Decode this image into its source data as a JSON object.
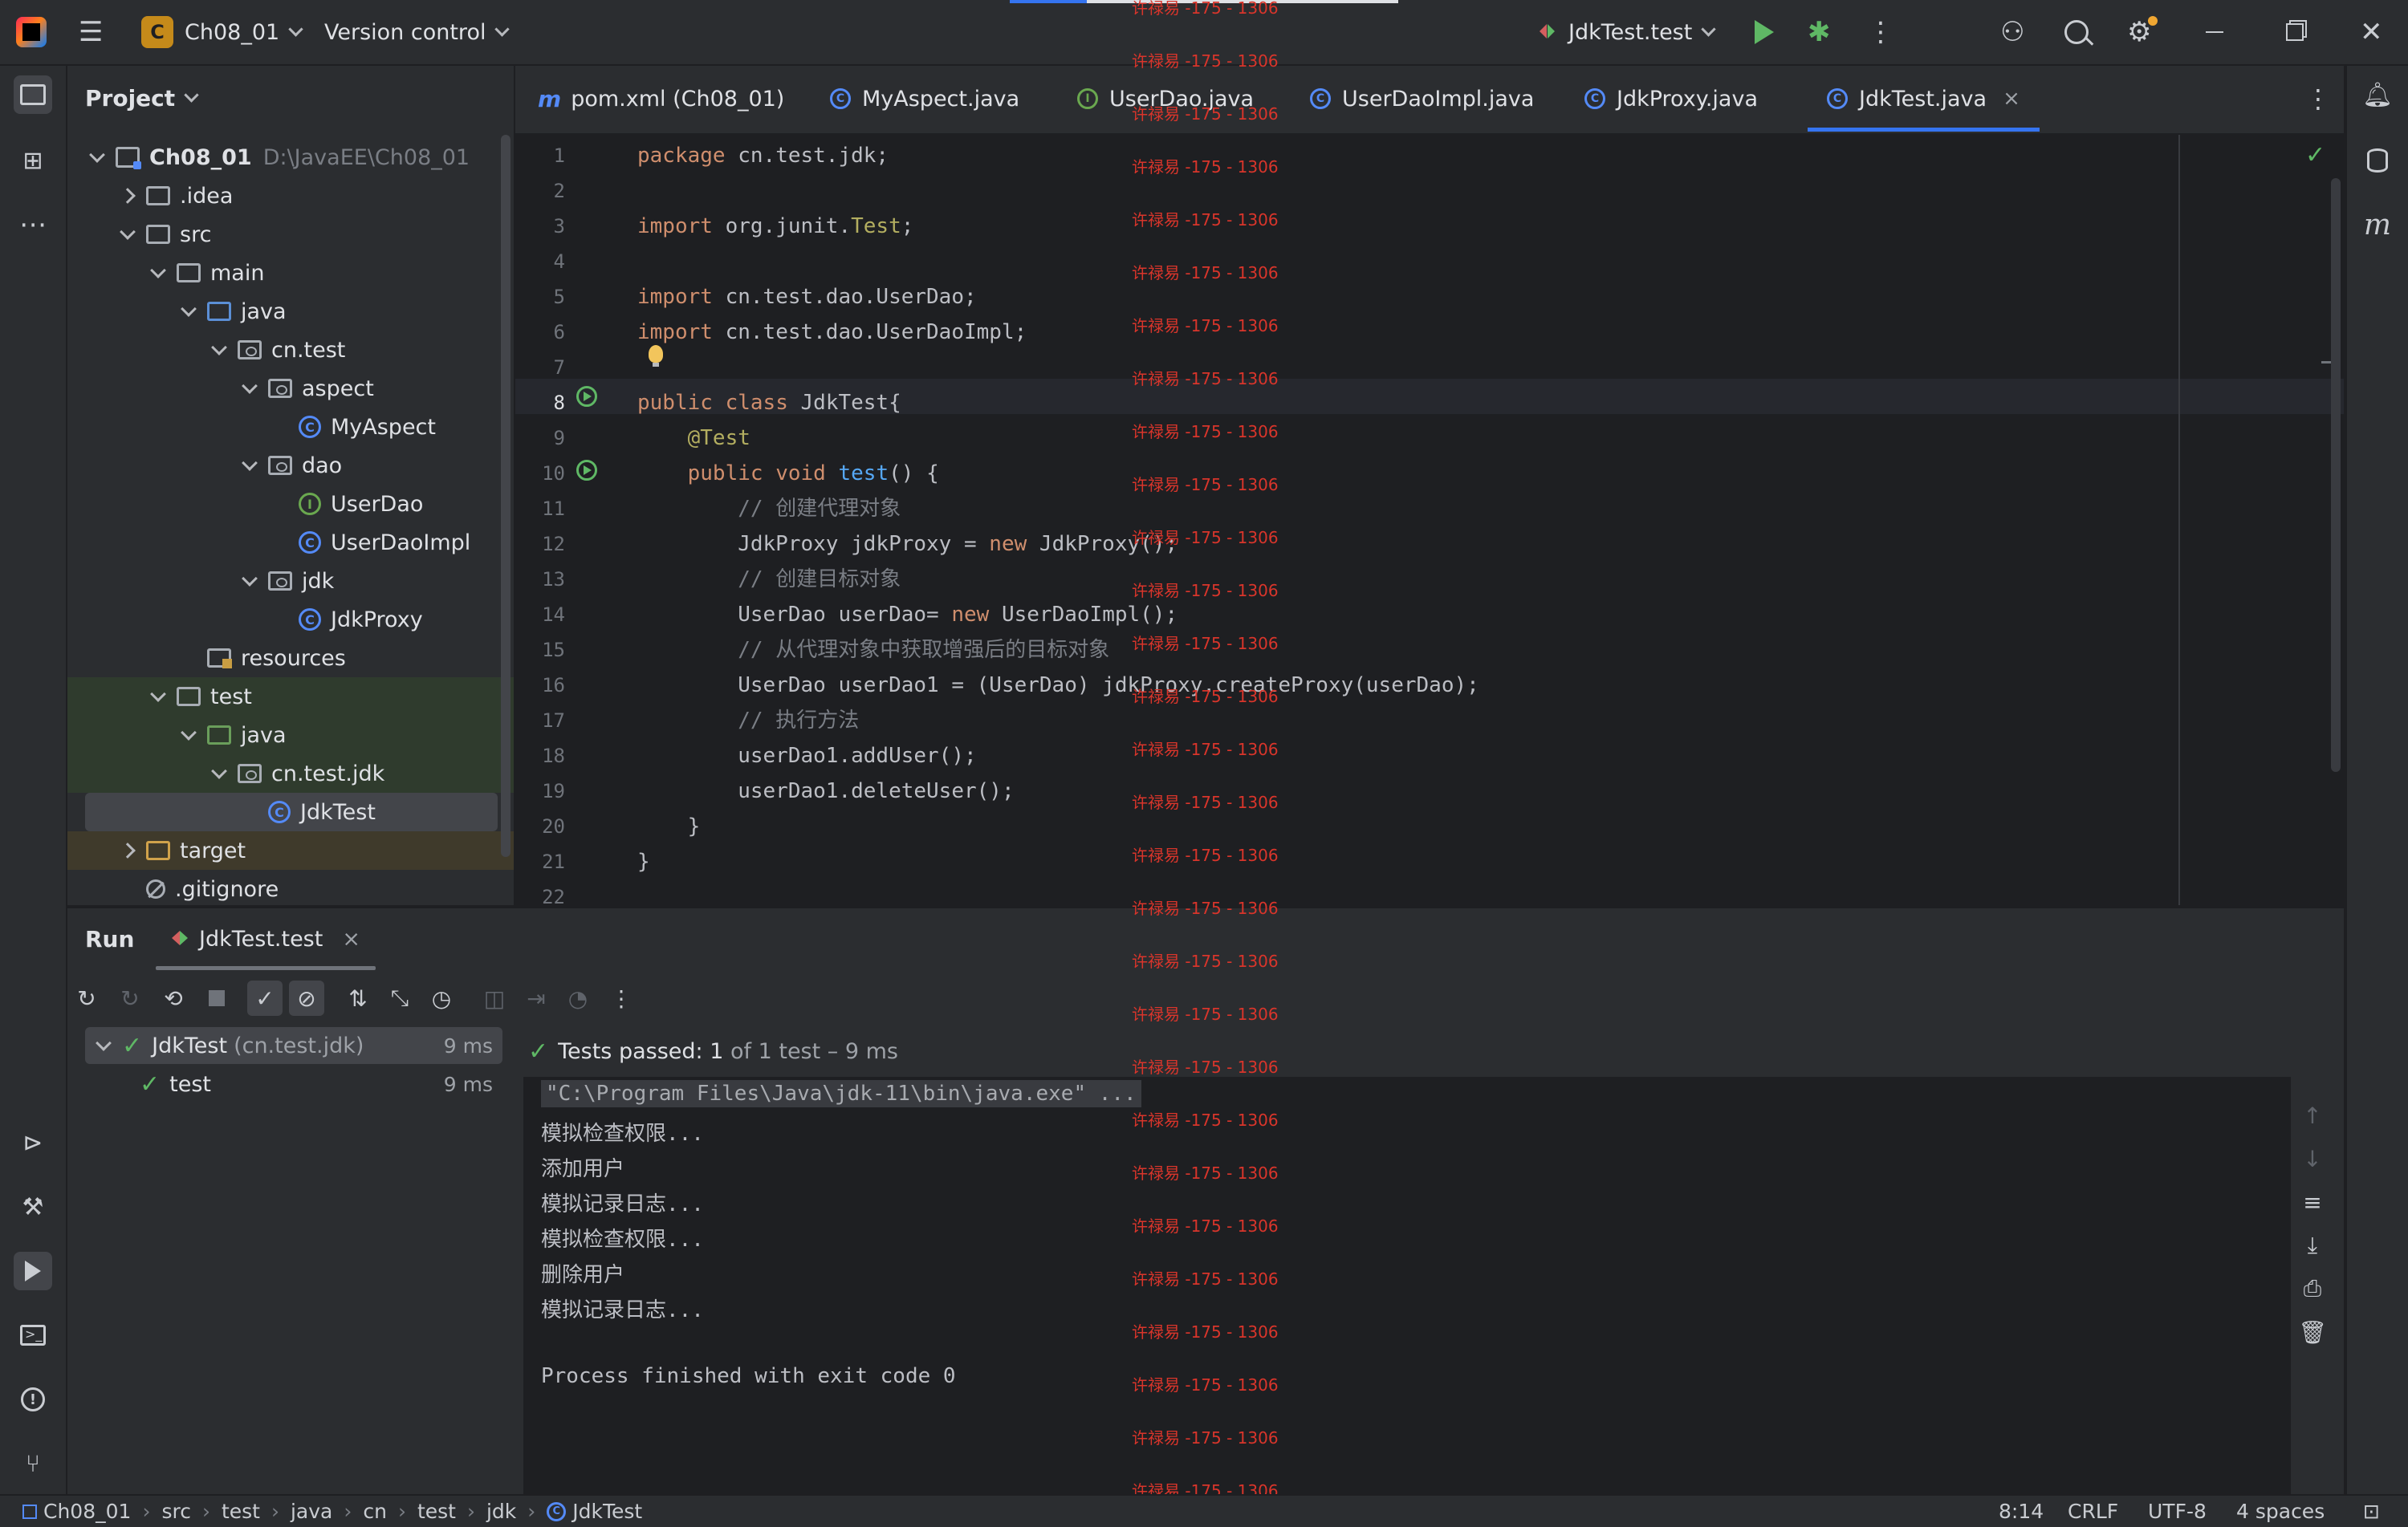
{
  "titlebar": {
    "project_badge": "C",
    "project_name": "Ch08_01",
    "vcs_label": "Version control",
    "run_config": "JdkTest.test"
  },
  "project_panel": {
    "title": "Project",
    "tree": [
      {
        "label": "Ch08_01",
        "path": "D:\\JavaEE\\Ch08_01",
        "kind": "module",
        "expand": "down"
      },
      {
        "label": ".idea",
        "kind": "folder",
        "expand": "right"
      },
      {
        "label": "src",
        "kind": "folder",
        "expand": "down"
      },
      {
        "label": "main",
        "kind": "folder",
        "expand": "down"
      },
      {
        "label": "java",
        "kind": "folder-blue",
        "expand": "down"
      },
      {
        "label": "cn.test",
        "kind": "package",
        "expand": "down"
      },
      {
        "label": "aspect",
        "kind": "package",
        "expand": "down"
      },
      {
        "label": "MyAspect",
        "kind": "class",
        "glyph": "C"
      },
      {
        "label": "dao",
        "kind": "package",
        "expand": "down"
      },
      {
        "label": "UserDao",
        "kind": "interface",
        "glyph": "I"
      },
      {
        "label": "UserDaoImpl",
        "kind": "class",
        "glyph": "C"
      },
      {
        "label": "jdk",
        "kind": "package",
        "expand": "down"
      },
      {
        "label": "JdkProxy",
        "kind": "class",
        "glyph": "C"
      },
      {
        "label": "resources",
        "kind": "resources"
      },
      {
        "label": "test",
        "kind": "folder",
        "expand": "down"
      },
      {
        "label": "java",
        "kind": "folder-green",
        "expand": "down"
      },
      {
        "label": "cn.test.jdk",
        "kind": "package",
        "expand": "down"
      },
      {
        "label": "JdkTest",
        "kind": "class",
        "glyph": "C"
      },
      {
        "label": "target",
        "kind": "folder-orange",
        "expand": "right"
      },
      {
        "label": ".gitignore",
        "kind": "ignore"
      }
    ]
  },
  "tabs": [
    {
      "label": "pom.xml (Ch08_01)",
      "glyph": "m"
    },
    {
      "label": "MyAspect.java",
      "glyph": "C"
    },
    {
      "label": "UserDao.java",
      "glyph": "I"
    },
    {
      "label": "UserDaoImpl.java",
      "glyph": "C"
    },
    {
      "label": "JdkProxy.java",
      "glyph": "C"
    },
    {
      "label": "JdkTest.java",
      "glyph": "C",
      "active": true,
      "close": "×"
    }
  ],
  "editor": {
    "lines": [
      {
        "n": "1",
        "code": "package cn.test.jdk;"
      },
      {
        "n": "2",
        "code": ""
      },
      {
        "n": "3",
        "code": "import org.junit.Test;"
      },
      {
        "n": "4",
        "code": ""
      },
      {
        "n": "5",
        "code": "import cn.test.dao.UserDao;"
      },
      {
        "n": "6",
        "code": "import cn.test.dao.UserDaoImpl;"
      },
      {
        "n": "7",
        "code": ""
      },
      {
        "n": "8",
        "code": "public class JdkTest{"
      },
      {
        "n": "9",
        "code": "    @Test"
      },
      {
        "n": "10",
        "code": "    public void test() {"
      },
      {
        "n": "11",
        "code": "        // 创建代理对象"
      },
      {
        "n": "12",
        "code": "        JdkProxy jdkProxy = new JdkProxy();"
      },
      {
        "n": "13",
        "code": "        // 创建目标对象"
      },
      {
        "n": "14",
        "code": "        UserDao userDao= new UserDaoImpl();"
      },
      {
        "n": "15",
        "code": "        // 从代理对象中获取增强后的目标对象"
      },
      {
        "n": "16",
        "code": "        UserDao userDao1 = (UserDao) jdkProxy.createProxy(userDao);"
      },
      {
        "n": "17",
        "code": "        // 执行方法"
      },
      {
        "n": "18",
        "code": "        userDao1.addUser();"
      },
      {
        "n": "19",
        "code": "        userDao1.deleteUser();"
      },
      {
        "n": "20",
        "code": "    }"
      },
      {
        "n": "21",
        "code": "}"
      },
      {
        "n": "22",
        "code": ""
      }
    ]
  },
  "watermark": "许禄易 -175 - 1306",
  "run_panel": {
    "title": "Run",
    "tab_label": "JdkTest.test",
    "tab_close": "×",
    "test_tree": [
      {
        "name": "JdkTest",
        "pkg": "(cn.test.jdk)",
        "duration": "9 ms"
      },
      {
        "name": "test",
        "pkg": "",
        "duration": "9 ms"
      }
    ],
    "passed_prefix": "Tests passed: ",
    "passed_count": "1",
    "passed_suffix": " of 1 test – 9 ms",
    "console": [
      "\"C:\\Program Files\\Java\\jdk-11\\bin\\java.exe\" ...",
      "模拟检查权限...",
      "添加用户",
      "模拟记录日志...",
      "模拟检查权限...",
      "删除用户",
      "模拟记录日志...",
      "",
      "Process finished with exit code 0"
    ]
  },
  "statusbar": {
    "breadcrumbs": [
      "Ch08_01",
      "src",
      "test",
      "java",
      "cn",
      "test",
      "jdk",
      "JdkTest"
    ],
    "position": "8:14",
    "line_sep": "CRLF",
    "encoding": "UTF-8",
    "indent": "4 spaces"
  },
  "colors": {
    "accent": "#3574f0",
    "success": "#5fb865",
    "keyword": "#cf8e6d",
    "annotation": "#b3ae60",
    "function": "#56a8f5",
    "comment": "#7a7e85"
  }
}
